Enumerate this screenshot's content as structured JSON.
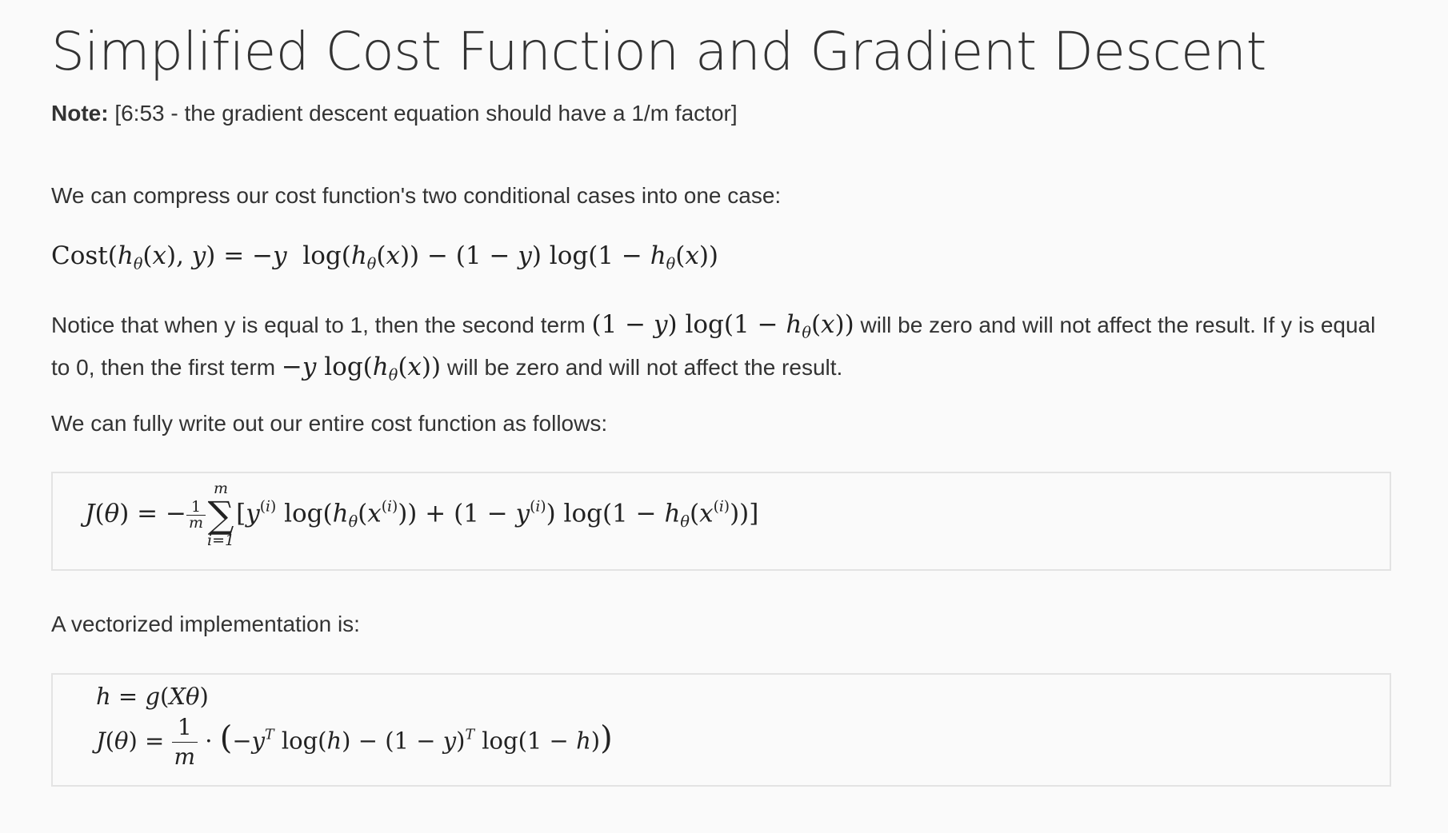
{
  "page": {
    "title": "Simplified Cost Function and Gradient Descent"
  },
  "note": {
    "label": "Note:",
    "text": "[6:53 - the gradient descent equation should have a 1/m factor]"
  },
  "intro_text": "We can compress our cost function's two conditional cases into one case:",
  "explanation": {
    "part1": "Notice that when y is equal to 1, then the second term",
    "part2": "will be zero and will not affect the result. If y is equal to 0, then the first term",
    "part3": "will be zero and will not affect the result."
  },
  "full_cost_text": "We can fully write out our entire cost function as follows:",
  "vectorized_text": "A vectorized implementation is:"
}
